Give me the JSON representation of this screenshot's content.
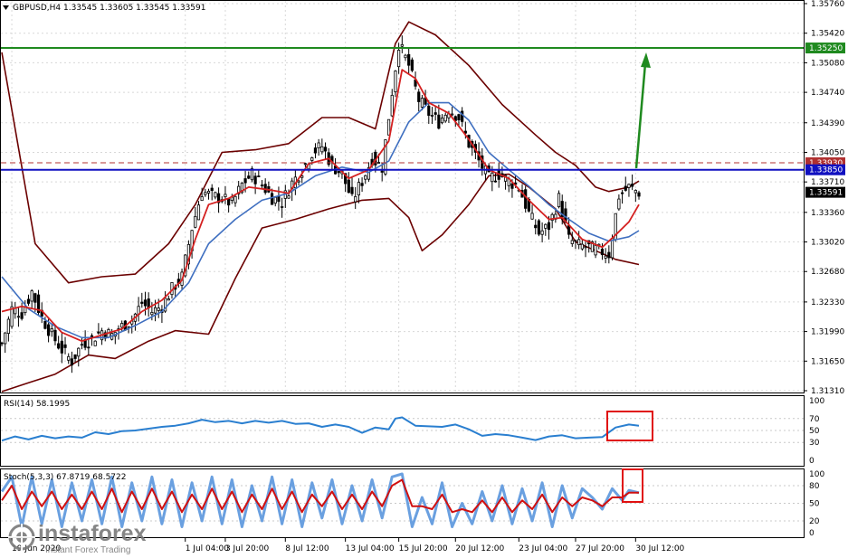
{
  "colors": {
    "candle": "#000000",
    "bollinger": "#6b0000",
    "ma_fast": "#d42020",
    "ma_slow": "#3f6fc0",
    "resistance": "#1f8a1f",
    "support": "#1010c0",
    "dashed": "#b03030",
    "rsi": "#2a7fd0",
    "stoch_main": "#6aa0e0",
    "stoch_signal": "#d01010",
    "box": "#e01010",
    "arrow": "#1f8a1f"
  },
  "header": {
    "text": "GBPUSD,H4  1.33545 1.33605 1.33545 1.33591"
  },
  "price_axis": {
    "min": 1.3131,
    "max": 1.3576,
    "ticks": [
      "1.35760",
      "1.35420",
      "1.35080",
      "1.34740",
      "1.34390",
      "1.34050",
      "1.33710",
      "1.33360",
      "1.33020",
      "1.32680",
      "1.32330",
      "1.31990",
      "1.31650",
      "1.31310"
    ],
    "tick_values": [
      1.3576,
      1.3542,
      1.3508,
      1.3474,
      1.3439,
      1.3405,
      1.3371,
      1.3336,
      1.3302,
      1.3268,
      1.3233,
      1.3199,
      1.3165,
      1.3131
    ]
  },
  "levels": {
    "resistance": {
      "value": 1.3525,
      "label": "1.35250"
    },
    "support": {
      "value": 1.3385,
      "label": "1.33850"
    },
    "dashed": {
      "value": 1.3393,
      "label": "1.33930"
    },
    "current": {
      "value": 1.33591,
      "label": "1.33591"
    }
  },
  "rsi": {
    "label": "RSI(14) 58.1995",
    "ticks": [
      "100",
      "70",
      "50",
      "30",
      "0"
    ],
    "tick_values": [
      100,
      70,
      50,
      30,
      0
    ]
  },
  "stoch": {
    "label": "Stoch(5,3,3) 67.8719 68.5722",
    "ticks": [
      "100",
      "80",
      "50",
      "20",
      "0"
    ],
    "tick_values": [
      100,
      80,
      50,
      20,
      0
    ]
  },
  "time_axis": {
    "ticks": [
      "19 Jun 2020",
      "1 Jul 04:00",
      "3 Jul 20:00",
      "8 Jul 12:00",
      "13 Jul 04:00",
      "15 Jul 20:00",
      "20 Jul 12:00",
      "23 Jul 04:00",
      "27 Jul 20:00",
      "30 Jul 12:00"
    ],
    "tick_index": [
      3,
      55,
      67,
      85,
      103,
      119,
      136,
      155,
      172,
      190
    ]
  },
  "watermark": {
    "brand": "instaforex",
    "tagline": "Instant Forex Trading"
  },
  "chart_data": {
    "type": "candlestick",
    "title": "GBPUSD,H4  1.33545 1.33605 1.33545 1.33591",
    "x_labels": [
      "19 Jun 2020",
      "1 Jul 04:00",
      "3 Jul 20:00",
      "8 Jul 12:00",
      "13 Jul 04:00",
      "15 Jul 20:00",
      "20 Jul 12:00",
      "23 Jul 04:00",
      "27 Jul 20:00",
      "30 Jul 12:00"
    ],
    "ylim": [
      1.3131,
      1.3576
    ],
    "close_anchors": [
      [
        0,
        1.3185
      ],
      [
        3,
        1.3225
      ],
      [
        6,
        1.322
      ],
      [
        9,
        1.3245
      ],
      [
        12,
        1.3215
      ],
      [
        15,
        1.3195
      ],
      [
        18,
        1.3178
      ],
      [
        21,
        1.3165
      ],
      [
        24,
        1.3185
      ],
      [
        27,
        1.319
      ],
      [
        30,
        1.32
      ],
      [
        33,
        1.3195
      ],
      [
        36,
        1.3205
      ],
      [
        39,
        1.3212
      ],
      [
        42,
        1.3232
      ],
      [
        45,
        1.3222
      ],
      [
        48,
        1.3228
      ],
      [
        51,
        1.3248
      ],
      [
        54,
        1.3262
      ],
      [
        57,
        1.3318
      ],
      [
        60,
        1.336
      ],
      [
        63,
        1.3355
      ],
      [
        66,
        1.3352
      ],
      [
        69,
        1.3346
      ],
      [
        72,
        1.3368
      ],
      [
        75,
        1.338
      ],
      [
        78,
        1.3368
      ],
      [
        81,
        1.3353
      ],
      [
        84,
        1.3348
      ],
      [
        87,
        1.337
      ],
      [
        90,
        1.3385
      ],
      [
        93,
        1.3405
      ],
      [
        96,
        1.3412
      ],
      [
        99,
        1.339
      ],
      [
        102,
        1.338
      ],
      [
        105,
        1.335
      ],
      [
        108,
        1.3372
      ],
      [
        111,
        1.3398
      ],
      [
        114,
        1.3388
      ],
      [
        117,
        1.3475
      ],
      [
        119,
        1.353
      ],
      [
        122,
        1.3505
      ],
      [
        125,
        1.3465
      ],
      [
        128,
        1.345
      ],
      [
        131,
        1.344
      ],
      [
        134,
        1.3455
      ],
      [
        137,
        1.3445
      ],
      [
        140,
        1.3415
      ],
      [
        143,
        1.3395
      ],
      [
        146,
        1.3375
      ],
      [
        149,
        1.338
      ],
      [
        152,
        1.3372
      ],
      [
        155,
        1.3365
      ],
      [
        158,
        1.3335
      ],
      [
        161,
        1.3312
      ],
      [
        164,
        1.332
      ],
      [
        167,
        1.3352
      ],
      [
        170,
        1.3305
      ],
      [
        173,
        1.3298
      ],
      [
        176,
        1.3296
      ],
      [
        179,
        1.3292
      ],
      [
        182,
        1.3288
      ],
      [
        185,
        1.3355
      ],
      [
        188,
        1.3365
      ],
      [
        191,
        1.3359
      ]
    ],
    "bollinger_upper": [
      [
        0,
        1.352
      ],
      [
        10,
        1.33
      ],
      [
        20,
        1.3255
      ],
      [
        30,
        1.3262
      ],
      [
        40,
        1.3265
      ],
      [
        50,
        1.33
      ],
      [
        58,
        1.3345
      ],
      [
        66,
        1.3405
      ],
      [
        76,
        1.3408
      ],
      [
        86,
        1.3415
      ],
      [
        96,
        1.3445
      ],
      [
        104,
        1.3445
      ],
      [
        112,
        1.3432
      ],
      [
        118,
        1.353
      ],
      [
        122,
        1.3555
      ],
      [
        130,
        1.354
      ],
      [
        140,
        1.3505
      ],
      [
        150,
        1.346
      ],
      [
        160,
        1.3425
      ],
      [
        166,
        1.3405
      ],
      [
        172,
        1.339
      ],
      [
        178,
        1.3365
      ],
      [
        182,
        1.336
      ],
      [
        188,
        1.3365
      ],
      [
        191,
        1.3372
      ]
    ],
    "bollinger_lower": [
      [
        0,
        1.313
      ],
      [
        8,
        1.314
      ],
      [
        16,
        1.315
      ],
      [
        26,
        1.3172
      ],
      [
        34,
        1.3168
      ],
      [
        44,
        1.3188
      ],
      [
        52,
        1.32
      ],
      [
        62,
        1.3196
      ],
      [
        70,
        1.326
      ],
      [
        78,
        1.3318
      ],
      [
        88,
        1.3328
      ],
      [
        98,
        1.334
      ],
      [
        108,
        1.335
      ],
      [
        116,
        1.3352
      ],
      [
        122,
        1.333
      ],
      [
        126,
        1.3292
      ],
      [
        132,
        1.331
      ],
      [
        140,
        1.3345
      ],
      [
        146,
        1.3378
      ],
      [
        152,
        1.338
      ],
      [
        158,
        1.3365
      ],
      [
        166,
        1.334
      ],
      [
        172,
        1.3302
      ],
      [
        178,
        1.3292
      ],
      [
        184,
        1.3282
      ],
      [
        191,
        1.3276
      ]
    ],
    "ma_fast": [
      [
        0,
        1.3222
      ],
      [
        6,
        1.3228
      ],
      [
        12,
        1.3223
      ],
      [
        18,
        1.3198
      ],
      [
        24,
        1.3188
      ],
      [
        30,
        1.3195
      ],
      [
        36,
        1.3202
      ],
      [
        42,
        1.3222
      ],
      [
        48,
        1.3235
      ],
      [
        54,
        1.3258
      ],
      [
        58,
        1.3305
      ],
      [
        62,
        1.3345
      ],
      [
        68,
        1.3352
      ],
      [
        74,
        1.3365
      ],
      [
        80,
        1.3362
      ],
      [
        86,
        1.3358
      ],
      [
        92,
        1.3392
      ],
      [
        98,
        1.3398
      ],
      [
        104,
        1.3375
      ],
      [
        110,
        1.3385
      ],
      [
        116,
        1.3418
      ],
      [
        120,
        1.35
      ],
      [
        124,
        1.349
      ],
      [
        128,
        1.3462
      ],
      [
        134,
        1.345
      ],
      [
        140,
        1.342
      ],
      [
        146,
        1.3385
      ],
      [
        152,
        1.3375
      ],
      [
        158,
        1.335
      ],
      [
        164,
        1.3328
      ],
      [
        168,
        1.333
      ],
      [
        174,
        1.3305
      ],
      [
        180,
        1.3296
      ],
      [
        184,
        1.331
      ],
      [
        188,
        1.3325
      ],
      [
        191,
        1.3345
      ]
    ],
    "ma_slow": [
      [
        0,
        1.3262
      ],
      [
        8,
        1.3225
      ],
      [
        16,
        1.3205
      ],
      [
        24,
        1.3192
      ],
      [
        32,
        1.3192
      ],
      [
        40,
        1.3206
      ],
      [
        48,
        1.3222
      ],
      [
        56,
        1.3255
      ],
      [
        62,
        1.33
      ],
      [
        70,
        1.3328
      ],
      [
        78,
        1.335
      ],
      [
        86,
        1.3358
      ],
      [
        94,
        1.3378
      ],
      [
        102,
        1.3388
      ],
      [
        110,
        1.3382
      ],
      [
        116,
        1.3395
      ],
      [
        122,
        1.344
      ],
      [
        128,
        1.3462
      ],
      [
        134,
        1.3462
      ],
      [
        140,
        1.3442
      ],
      [
        146,
        1.3405
      ],
      [
        152,
        1.3385
      ],
      [
        158,
        1.3366
      ],
      [
        164,
        1.3345
      ],
      [
        170,
        1.3328
      ],
      [
        176,
        1.3312
      ],
      [
        182,
        1.3303
      ],
      [
        188,
        1.3308
      ],
      [
        191,
        1.3315
      ]
    ],
    "rsi_series": [
      [
        0,
        33
      ],
      [
        4,
        40
      ],
      [
        8,
        35
      ],
      [
        12,
        41
      ],
      [
        16,
        37
      ],
      [
        20,
        40
      ],
      [
        24,
        38
      ],
      [
        28,
        47
      ],
      [
        32,
        44
      ],
      [
        36,
        49
      ],
      [
        40,
        50
      ],
      [
        44,
        53
      ],
      [
        48,
        56
      ],
      [
        52,
        58
      ],
      [
        56,
        62
      ],
      [
        60,
        68
      ],
      [
        64,
        64
      ],
      [
        68,
        66
      ],
      [
        72,
        62
      ],
      [
        76,
        66
      ],
      [
        80,
        63
      ],
      [
        84,
        66
      ],
      [
        88,
        61
      ],
      [
        92,
        62
      ],
      [
        96,
        56
      ],
      [
        100,
        60
      ],
      [
        104,
        56
      ],
      [
        108,
        46
      ],
      [
        112,
        55
      ],
      [
        116,
        52
      ],
      [
        118,
        70
      ],
      [
        120,
        72
      ],
      [
        124,
        58
      ],
      [
        128,
        57
      ],
      [
        132,
        56
      ],
      [
        136,
        60
      ],
      [
        140,
        52
      ],
      [
        144,
        41
      ],
      [
        148,
        44
      ],
      [
        152,
        42
      ],
      [
        156,
        38
      ],
      [
        160,
        34
      ],
      [
        164,
        40
      ],
      [
        168,
        42
      ],
      [
        172,
        37
      ],
      [
        176,
        38
      ],
      [
        180,
        39
      ],
      [
        184,
        55
      ],
      [
        188,
        60
      ],
      [
        191,
        58
      ]
    ],
    "stoch_main": [
      [
        0,
        70
      ],
      [
        3,
        95
      ],
      [
        6,
        10
      ],
      [
        9,
        95
      ],
      [
        12,
        15
      ],
      [
        15,
        90
      ],
      [
        18,
        10
      ],
      [
        21,
        85
      ],
      [
        24,
        20
      ],
      [
        27,
        90
      ],
      [
        30,
        15
      ],
      [
        33,
        95
      ],
      [
        36,
        10
      ],
      [
        39,
        85
      ],
      [
        42,
        20
      ],
      [
        45,
        95
      ],
      [
        48,
        15
      ],
      [
        51,
        90
      ],
      [
        54,
        10
      ],
      [
        57,
        85
      ],
      [
        60,
        20
      ],
      [
        63,
        95
      ],
      [
        66,
        15
      ],
      [
        69,
        90
      ],
      [
        72,
        10
      ],
      [
        75,
        80
      ],
      [
        78,
        20
      ],
      [
        81,
        95
      ],
      [
        84,
        15
      ],
      [
        87,
        90
      ],
      [
        90,
        10
      ],
      [
        93,
        85
      ],
      [
        96,
        25
      ],
      [
        99,
        90
      ],
      [
        102,
        15
      ],
      [
        105,
        80
      ],
      [
        108,
        20
      ],
      [
        111,
        90
      ],
      [
        114,
        25
      ],
      [
        117,
        95
      ],
      [
        120,
        100
      ],
      [
        123,
        10
      ],
      [
        126,
        60
      ],
      [
        129,
        15
      ],
      [
        132,
        85
      ],
      [
        135,
        10
      ],
      [
        138,
        50
      ],
      [
        141,
        15
      ],
      [
        144,
        70
      ],
      [
        147,
        20
      ],
      [
        150,
        80
      ],
      [
        153,
        15
      ],
      [
        156,
        75
      ],
      [
        159,
        20
      ],
      [
        162,
        85
      ],
      [
        165,
        10
      ],
      [
        168,
        80
      ],
      [
        171,
        25
      ],
      [
        174,
        75
      ],
      [
        177,
        60
      ],
      [
        180,
        40
      ],
      [
        183,
        75
      ],
      [
        186,
        55
      ],
      [
        188,
        72
      ],
      [
        191,
        68
      ]
    ],
    "stoch_signal": [
      [
        0,
        55
      ],
      [
        3,
        80
      ],
      [
        6,
        40
      ],
      [
        9,
        70
      ],
      [
        12,
        45
      ],
      [
        15,
        70
      ],
      [
        18,
        40
      ],
      [
        21,
        65
      ],
      [
        24,
        40
      ],
      [
        27,
        70
      ],
      [
        30,
        40
      ],
      [
        33,
        75
      ],
      [
        36,
        35
      ],
      [
        39,
        70
      ],
      [
        42,
        40
      ],
      [
        45,
        75
      ],
      [
        48,
        40
      ],
      [
        51,
        70
      ],
      [
        54,
        35
      ],
      [
        57,
        65
      ],
      [
        60,
        40
      ],
      [
        63,
        75
      ],
      [
        66,
        40
      ],
      [
        69,
        70
      ],
      [
        72,
        35
      ],
      [
        75,
        65
      ],
      [
        78,
        40
      ],
      [
        81,
        75
      ],
      [
        84,
        40
      ],
      [
        87,
        70
      ],
      [
        90,
        35
      ],
      [
        93,
        65
      ],
      [
        96,
        45
      ],
      [
        99,
        70
      ],
      [
        102,
        40
      ],
      [
        105,
        65
      ],
      [
        108,
        40
      ],
      [
        111,
        70
      ],
      [
        114,
        45
      ],
      [
        117,
        80
      ],
      [
        120,
        90
      ],
      [
        123,
        45
      ],
      [
        126,
        45
      ],
      [
        129,
        40
      ],
      [
        132,
        65
      ],
      [
        135,
        35
      ],
      [
        138,
        40
      ],
      [
        141,
        35
      ],
      [
        144,
        55
      ],
      [
        147,
        35
      ],
      [
        150,
        60
      ],
      [
        153,
        35
      ],
      [
        156,
        55
      ],
      [
        159,
        40
      ],
      [
        162,
        65
      ],
      [
        165,
        35
      ],
      [
        168,
        60
      ],
      [
        171,
        45
      ],
      [
        174,
        60
      ],
      [
        177,
        55
      ],
      [
        180,
        45
      ],
      [
        183,
        60
      ],
      [
        186,
        60
      ],
      [
        188,
        68
      ],
      [
        191,
        68
      ]
    ]
  }
}
